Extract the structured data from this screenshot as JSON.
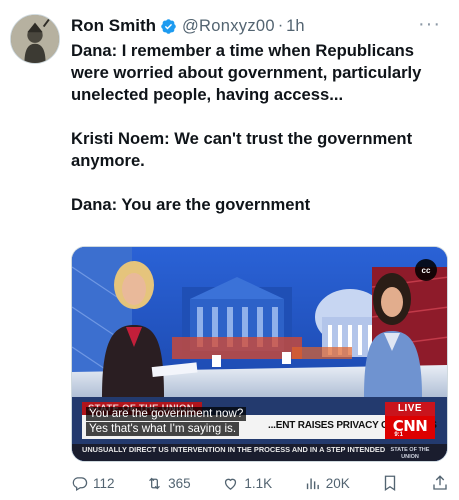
{
  "post": {
    "author_name": "Ron Smith",
    "handle": "@Ronxyz00",
    "separator": "·",
    "time": "1h",
    "more_label": "···",
    "paragraphs": [
      "Dana: I remember a time when Republicans were worried about government, particularly unelected people, having access...",
      "Kristi Noem: We can't trust the government anymore.",
      "Dana: You are the government"
    ]
  },
  "video": {
    "cc_label": "cc",
    "show_name": "STATE OF THE UNION",
    "headline": "...ENT RAISES PRIVACY CONCERNS",
    "ticker": "UNUSUALLY DIRECT US INTERVENTION IN THE PROCESS AND IN A STEP INTENDED TO",
    "live_label": "LIVE",
    "network_logo": "CNN",
    "clock": "9:1",
    "network_tag": "STATE OF THE UNION",
    "subtitle_line1": "You are the government now?",
    "subtitle_line2": "Yes that's what I'm saying is."
  },
  "actions": {
    "replies": "112",
    "reposts": "365",
    "likes": "1.1K",
    "views": "20K"
  },
  "colors": {
    "verified_blue": "#1d9bf0",
    "secondary_text": "#536471",
    "cnn_red": "#cc0000"
  },
  "icons": [
    "verified-badge-icon",
    "more-icon",
    "reply-icon",
    "repost-icon",
    "like-icon",
    "views-icon",
    "bookmark-icon",
    "share-icon"
  ]
}
